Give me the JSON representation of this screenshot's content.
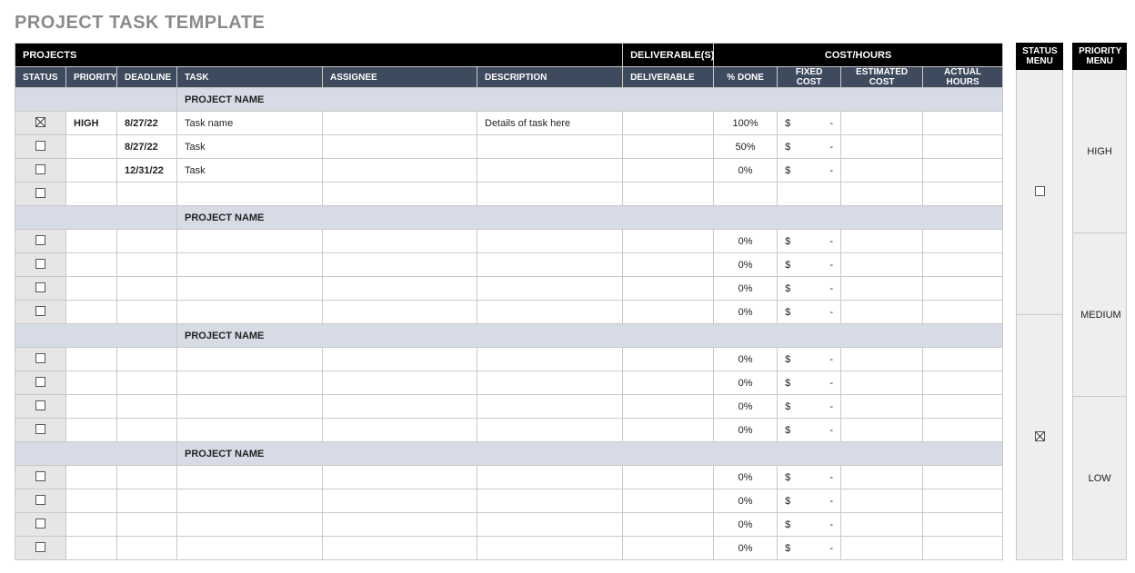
{
  "title": "PROJECT TASK TEMPLATE",
  "bands": {
    "projects": "PROJECTS",
    "deliverables": "DELIVERABLE(S)",
    "cost_hours": "COST/HOURS"
  },
  "columns": {
    "status": "STATUS",
    "priority": "PRIORITY",
    "deadline": "DEADLINE",
    "task": "TASK",
    "assignee": "ASSIGNEE",
    "description": "DESCRIPTION",
    "deliverable": "DELIVERABLE",
    "percent_done": "% DONE",
    "fixed_cost": "FIXED COST",
    "estimated_cost": "ESTIMATED COST",
    "actual_hours": "ACTUAL HOURS"
  },
  "sections": [
    {
      "project_name": "PROJECT NAME",
      "rows": [
        {
          "status_checked": true,
          "priority": "HIGH",
          "deadline": "8/27/22",
          "task": "Task name",
          "assignee": "",
          "description": "Details of task here",
          "deliverable": "",
          "percent_done": "100%",
          "fixed_cost_symbol": "$",
          "fixed_cost_value": "-",
          "estimated_cost": "",
          "actual_hours": ""
        },
        {
          "status_checked": false,
          "priority": "",
          "deadline": "8/27/22",
          "task": "Task",
          "assignee": "",
          "description": "",
          "deliverable": "",
          "percent_done": "50%",
          "fixed_cost_symbol": "$",
          "fixed_cost_value": "-",
          "estimated_cost": "",
          "actual_hours": ""
        },
        {
          "status_checked": false,
          "priority": "",
          "deadline": "12/31/22",
          "task": "Task",
          "assignee": "",
          "description": "",
          "deliverable": "",
          "percent_done": "0%",
          "fixed_cost_symbol": "$",
          "fixed_cost_value": "-",
          "estimated_cost": "",
          "actual_hours": ""
        },
        {
          "status_checked": false,
          "priority": "",
          "deadline": "",
          "task": "",
          "assignee": "",
          "description": "",
          "deliverable": "",
          "percent_done": "",
          "fixed_cost_symbol": "",
          "fixed_cost_value": "",
          "estimated_cost": "",
          "actual_hours": ""
        }
      ]
    },
    {
      "project_name": "PROJECT NAME",
      "rows": [
        {
          "status_checked": false,
          "priority": "",
          "deadline": "",
          "task": "",
          "assignee": "",
          "description": "",
          "deliverable": "",
          "percent_done": "0%",
          "fixed_cost_symbol": "$",
          "fixed_cost_value": "-",
          "estimated_cost": "",
          "actual_hours": ""
        },
        {
          "status_checked": false,
          "priority": "",
          "deadline": "",
          "task": "",
          "assignee": "",
          "description": "",
          "deliverable": "",
          "percent_done": "0%",
          "fixed_cost_symbol": "$",
          "fixed_cost_value": "-",
          "estimated_cost": "",
          "actual_hours": ""
        },
        {
          "status_checked": false,
          "priority": "",
          "deadline": "",
          "task": "",
          "assignee": "",
          "description": "",
          "deliverable": "",
          "percent_done": "0%",
          "fixed_cost_symbol": "$",
          "fixed_cost_value": "-",
          "estimated_cost": "",
          "actual_hours": ""
        },
        {
          "status_checked": false,
          "priority": "",
          "deadline": "",
          "task": "",
          "assignee": "",
          "description": "",
          "deliverable": "",
          "percent_done": "0%",
          "fixed_cost_symbol": "$",
          "fixed_cost_value": "-",
          "estimated_cost": "",
          "actual_hours": ""
        }
      ]
    },
    {
      "project_name": "PROJECT NAME",
      "rows": [
        {
          "status_checked": false,
          "priority": "",
          "deadline": "",
          "task": "",
          "assignee": "",
          "description": "",
          "deliverable": "",
          "percent_done": "0%",
          "fixed_cost_symbol": "$",
          "fixed_cost_value": "-",
          "estimated_cost": "",
          "actual_hours": ""
        },
        {
          "status_checked": false,
          "priority": "",
          "deadline": "",
          "task": "",
          "assignee": "",
          "description": "",
          "deliverable": "",
          "percent_done": "0%",
          "fixed_cost_symbol": "$",
          "fixed_cost_value": "-",
          "estimated_cost": "",
          "actual_hours": ""
        },
        {
          "status_checked": false,
          "priority": "",
          "deadline": "",
          "task": "",
          "assignee": "",
          "description": "",
          "deliverable": "",
          "percent_done": "0%",
          "fixed_cost_symbol": "$",
          "fixed_cost_value": "-",
          "estimated_cost": "",
          "actual_hours": ""
        },
        {
          "status_checked": false,
          "priority": "",
          "deadline": "",
          "task": "",
          "assignee": "",
          "description": "",
          "deliverable": "",
          "percent_done": "0%",
          "fixed_cost_symbol": "$",
          "fixed_cost_value": "-",
          "estimated_cost": "",
          "actual_hours": ""
        }
      ]
    },
    {
      "project_name": "PROJECT NAME",
      "rows": [
        {
          "status_checked": false,
          "priority": "",
          "deadline": "",
          "task": "",
          "assignee": "",
          "description": "",
          "deliverable": "",
          "percent_done": "0%",
          "fixed_cost_symbol": "$",
          "fixed_cost_value": "-",
          "estimated_cost": "",
          "actual_hours": ""
        },
        {
          "status_checked": false,
          "priority": "",
          "deadline": "",
          "task": "",
          "assignee": "",
          "description": "",
          "deliverable": "",
          "percent_done": "0%",
          "fixed_cost_symbol": "$",
          "fixed_cost_value": "-",
          "estimated_cost": "",
          "actual_hours": ""
        },
        {
          "status_checked": false,
          "priority": "",
          "deadline": "",
          "task": "",
          "assignee": "",
          "description": "",
          "deliverable": "",
          "percent_done": "0%",
          "fixed_cost_symbol": "$",
          "fixed_cost_value": "-",
          "estimated_cost": "",
          "actual_hours": ""
        },
        {
          "status_checked": false,
          "priority": "",
          "deadline": "",
          "task": "",
          "assignee": "",
          "description": "",
          "deliverable": "",
          "percent_done": "0%",
          "fixed_cost_symbol": "$",
          "fixed_cost_value": "-",
          "estimated_cost": "",
          "actual_hours": ""
        }
      ]
    }
  ],
  "status_menu": {
    "title_line1": "STATUS",
    "title_line2": "MENU",
    "items": [
      {
        "checked": false
      },
      {
        "checked": true
      }
    ]
  },
  "priority_menu": {
    "title_line1": "PRIORITY",
    "title_line2": "MENU",
    "items": [
      "HIGH",
      "MEDIUM",
      "LOW"
    ]
  }
}
